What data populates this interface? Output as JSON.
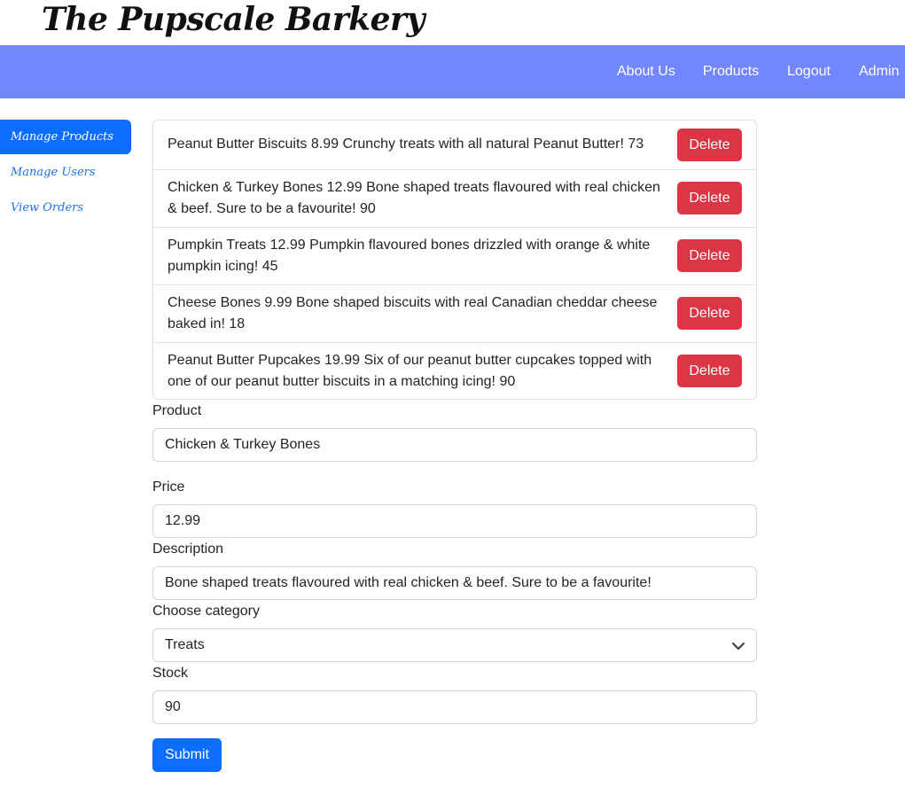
{
  "brand": "The Pupscale Barkery",
  "nav": [
    "About Us",
    "Products",
    "Logout",
    "Admin"
  ],
  "sidebar": [
    {
      "label": "Manage Products",
      "active": true
    },
    {
      "label": "Manage Users",
      "active": false
    },
    {
      "label": "View Orders",
      "active": false
    }
  ],
  "products": [
    {
      "text": "Peanut Butter Biscuits 8.99 Crunchy treats with all natural Peanut Butter! 73",
      "delete_label": "Delete"
    },
    {
      "text": "Chicken & Turkey Bones 12.99 Bone shaped treats flavoured with real chicken & beef. Sure to be a favourite! 90",
      "delete_label": "Delete"
    },
    {
      "text": "Pumpkin Treats 12.99 Pumpkin flavoured bones drizzled with orange & white pumpkin icing! 45",
      "delete_label": "Delete"
    },
    {
      "text": "Cheese Bones 9.99 Bone shaped biscuits with real Canadian cheddar cheese baked in! 18",
      "delete_label": "Delete"
    },
    {
      "text": "Peanut Butter Pupcakes 19.99 Six of our peanut butter cupcakes topped with one of our peanut butter biscuits in a matching icing! 90",
      "delete_label": "Delete"
    }
  ],
  "form": {
    "product_label": "Product",
    "product_value": "Chicken & Turkey Bones",
    "price_label": "Price",
    "price_value": "12.99",
    "description_label": "Description",
    "description_value": "Bone shaped treats flavoured with real chicken & beef.  Sure to be a favourite!",
    "category_label": "Choose category",
    "category_value": "Treats",
    "stock_label": "Stock",
    "stock_value": "90",
    "submit_label": "Submit"
  },
  "icons": {
    "select": "chevron-down-icon"
  },
  "colors": {
    "navbar": "#7286ff",
    "primary": "#0d6efd",
    "danger": "#dc3545"
  }
}
